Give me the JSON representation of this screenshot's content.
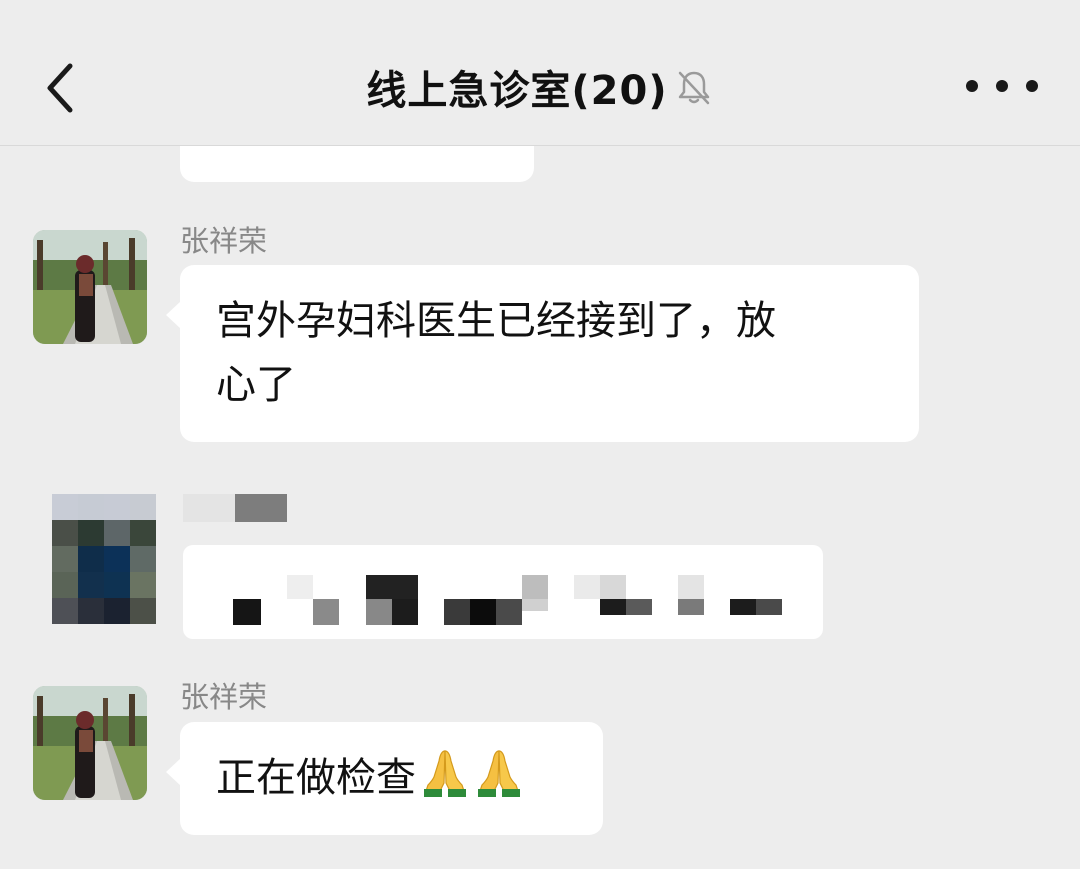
{
  "header": {
    "title": "线上急诊室(20)",
    "back_icon": "chevron-left-icon",
    "mute_icon": "bell-off-icon",
    "more_icon": "more-dots-icon"
  },
  "messages": [
    {
      "sender": "张祥荣",
      "text": "宫外孕妇科医生已经接到了，放心了",
      "line1": "宫外孕妇科医生已经接到了，放",
      "line2": "心了"
    },
    {
      "sender": "",
      "text": "",
      "pixelated": true
    },
    {
      "sender": "张祥荣",
      "text": "正在做检查",
      "emoji": [
        "folded-hands",
        "folded-hands"
      ]
    }
  ],
  "colors": {
    "background": "#ededed",
    "bubble": "#ffffff",
    "sender_name": "#888888",
    "text": "#111111"
  }
}
